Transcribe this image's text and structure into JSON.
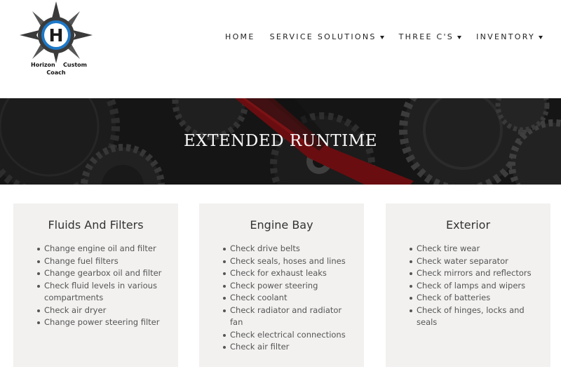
{
  "logo": {
    "letter": "H",
    "text_line1": [
      "Horizon",
      "Custom"
    ],
    "text_line2": "Coach"
  },
  "nav": {
    "items": [
      {
        "label": "HOME",
        "dropdown": false
      },
      {
        "label": "SERVICE SOLUTIONS",
        "dropdown": true
      },
      {
        "label": "THREE C'S",
        "dropdown": true
      },
      {
        "label": "INVENTORY",
        "dropdown": true
      }
    ]
  },
  "banner": {
    "title": "EXTENDED RUNTIME"
  },
  "cards": [
    {
      "title": "Fluids And Filters",
      "items": [
        "Change engine oil and filter",
        "Change fuel filters",
        "Change gearbox oil and filter",
        "Check fluid levels in various compartments",
        "Check air dryer",
        "Change power steering filter"
      ]
    },
    {
      "title": "Engine Bay",
      "items": [
        "Check drive belts",
        "Check seals, hoses and lines",
        "Check for exhaust leaks",
        "Check power steering",
        "Check coolant",
        "Check radiator and radiator fan",
        "Check electrical connections",
        "Check air filter"
      ]
    },
    {
      "title": "Exterior",
      "items": [
        "Check tire wear",
        "Check water separator",
        "Check mirrors and reflectors",
        "Check of lamps and wipers",
        "Check of batteries",
        "Check of hinges, locks and seals"
      ]
    }
  ],
  "colors": {
    "logo_blue": "#1c78c8",
    "banner_dark": "#1b1b1b",
    "banner_red": "#8e1216",
    "card_bg": "#f2f1f0"
  }
}
